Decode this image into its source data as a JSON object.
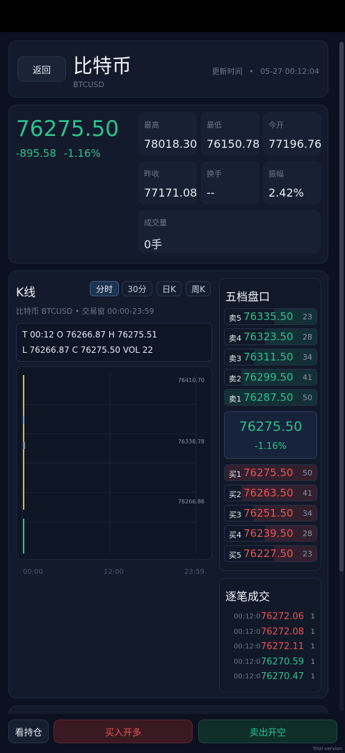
{
  "header": {
    "back_label": "返回",
    "asset_name": "比特币",
    "asset_code": "BTCUSD",
    "update_label": "更新时间",
    "update_sep": "•",
    "update_value": "05-27 00:12:04"
  },
  "quote": {
    "price": "76275.50",
    "change": "-895.58",
    "change_pct": "-1.16%",
    "stats": [
      {
        "label": "最高",
        "value": "78018.30"
      },
      {
        "label": "最低",
        "value": "76150.78"
      },
      {
        "label": "今开",
        "value": "77196.76"
      },
      {
        "label": "昨收",
        "value": "77171.08"
      },
      {
        "label": "换手",
        "value": "--"
      },
      {
        "label": "振幅",
        "value": "2.42%"
      },
      {
        "label": "成交量",
        "value": "0手"
      }
    ]
  },
  "kline": {
    "title": "K线",
    "timeframes": [
      "分时",
      "30分",
      "日K",
      "周K"
    ],
    "active_timeframe": "分时",
    "sub_info": "比特币 BTCUSD  •  交易窗 00:00-23:59",
    "ohlc_row1": "T 00:12   O 76266.87   H 76275.51",
    "ohlc_row2": "L 76266.87   C 76275.50   VOL 22",
    "colors": {
      "up": "#2ec08f",
      "down": "#ea5353",
      "candle": "#f0b429"
    }
  },
  "chart_data": {
    "type": "line",
    "y_tick_labels": [
      "76410.70",
      "76338.78",
      "76266.86"
    ],
    "x_tick_labels": [
      "00:00",
      "12:00",
      "23:59"
    ],
    "ylim": [
      76266.86,
      76410.7
    ],
    "grid": true
  },
  "orderbook": {
    "title": "五档盘口",
    "asks": [
      {
        "name": "卖5",
        "price": "76335.50",
        "qty": "23",
        "depth": 0.46
      },
      {
        "name": "卖4",
        "price": "76323.50",
        "qty": "28",
        "depth": 0.56
      },
      {
        "name": "卖3",
        "price": "76311.50",
        "qty": "34",
        "depth": 0.68
      },
      {
        "name": "卖2",
        "price": "76299.50",
        "qty": "41",
        "depth": 0.82
      },
      {
        "name": "卖1",
        "price": "76287.50",
        "qty": "50",
        "depth": 1.0
      }
    ],
    "mid_price": "76275.50",
    "mid_pct": "-1.16%",
    "bids": [
      {
        "name": "买1",
        "price": "76275.50",
        "qty": "50",
        "depth": 1.0
      },
      {
        "name": "买2",
        "price": "76263.50",
        "qty": "41",
        "depth": 0.82
      },
      {
        "name": "买3",
        "price": "76251.50",
        "qty": "34",
        "depth": 0.68
      },
      {
        "name": "买4",
        "price": "76239.50",
        "qty": "28",
        "depth": 0.56
      },
      {
        "name": "买5",
        "price": "76227.50",
        "qty": "23",
        "depth": 0.46
      }
    ]
  },
  "trades": {
    "title": "逐笔成交",
    "rows": [
      {
        "time": "00:12:0",
        "price": "76272.06",
        "qty": "1",
        "side": "sell"
      },
      {
        "time": "00:12:0",
        "price": "76272.08",
        "qty": "1",
        "side": "sell"
      },
      {
        "time": "00:12:0",
        "price": "76272.11",
        "qty": "1",
        "side": "sell"
      },
      {
        "time": "00:12:0",
        "price": "76270.59",
        "qty": "1",
        "side": "buy"
      },
      {
        "time": "00:12:0",
        "price": "76270.47",
        "qty": "1",
        "side": "buy"
      }
    ]
  },
  "actions": {
    "hold_label": "看持仓",
    "buy_label": "买入开多",
    "sell_label": "卖出开空"
  },
  "watermark": "Trial version"
}
